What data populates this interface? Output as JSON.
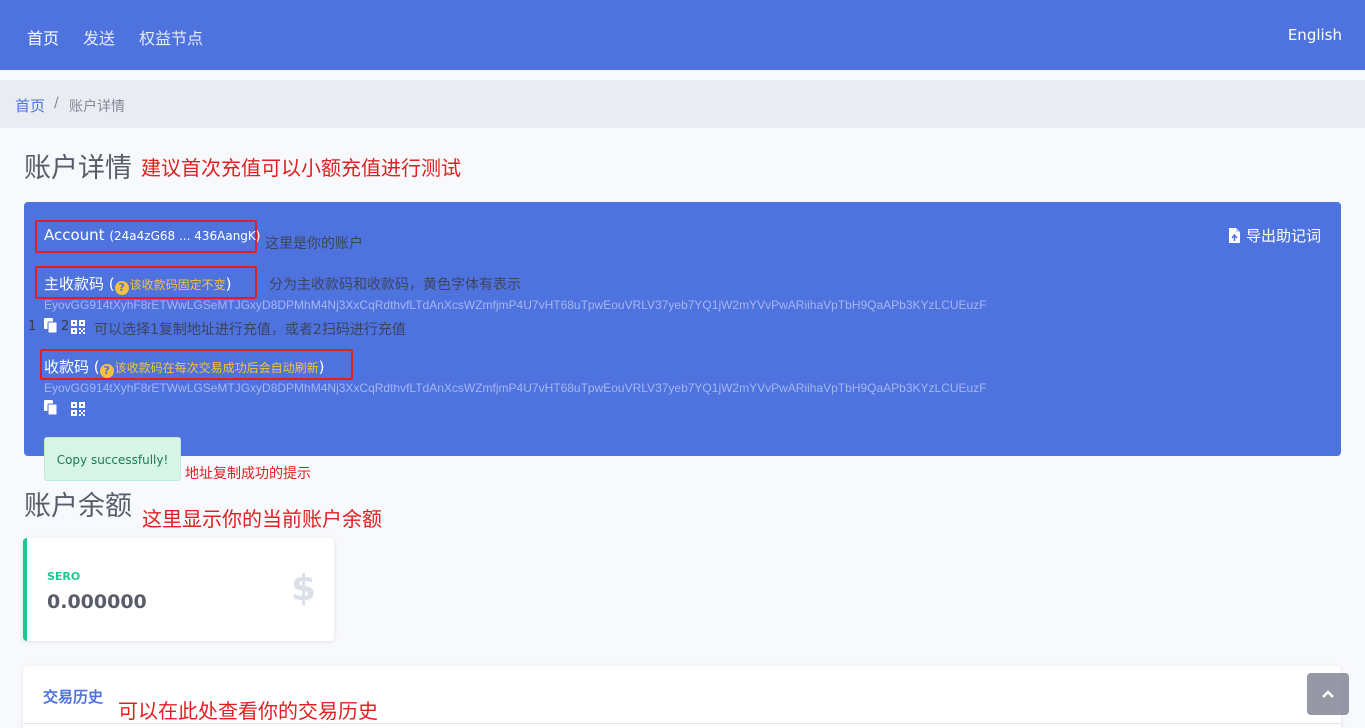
{
  "nav": {
    "items": [
      {
        "label": "首页"
      },
      {
        "label": "发送"
      },
      {
        "label": "权益节点"
      }
    ],
    "language": "English"
  },
  "breadcrumb": {
    "home": "首页",
    "separator": "/",
    "current": "账户详情"
  },
  "account_section": {
    "title": "账户详情",
    "annotation": "建议首次充值可以小额充值进行测试",
    "export_label": "导出助记词",
    "account_label": "Account",
    "account_short": "(24a4zG68 ... 436AangK)",
    "account_annotation": "这里是你的账户",
    "main_code_label": "主收款码",
    "main_code_warning": "该收款码固定不变",
    "main_code_annotation": "分为主收款码和收款码，黄色字体有表示",
    "main_code_address": "EyovGG914tXyhF8rETWwLGSeMTJGxyD8DPMhM4Nj3XxCqRdthvfLTdAnXcsWZmfjmP4U7vHT68uTpwEouVRLV37yeb7YQ1jW2mYVvPwARiihaVpTbH9QaAPb3KYzLCUEuzF",
    "num_one": "1",
    "num_two": "2",
    "icons_annotation": "可以选择1复制地址进行充值，或者2扫码进行充值",
    "code_label": "收款码",
    "code_warning": "该收款码在每次交易成功后会自动刷新",
    "code_address": "EyovGG914tXyhF8rETWwLGSeMTJGxyD8DPMhM4Nj3XxCqRdthvfLTdAnXcsWZmfjmP4U7vHT68uTpwEouVRLV37yeb7YQ1jW2mYVvPwARiihaVpTbH9QaAPb3KYzLCUEuzF"
  },
  "toast": {
    "message": "Copy successfully!",
    "annotation": "地址复制成功的提示"
  },
  "balance_section": {
    "title": "账户余额",
    "annotation": "这里显示你的当前账户余额",
    "currency": "SERO",
    "amount": "0.000000",
    "icon": "dollar-icon"
  },
  "history_section": {
    "title": "交易历史",
    "annotation": "可以在此处查看你的交易历史"
  },
  "colors": {
    "primary": "#4e73df",
    "success": "#1cc88a",
    "warning": "#f6c23e",
    "annotation": "#e02020"
  }
}
